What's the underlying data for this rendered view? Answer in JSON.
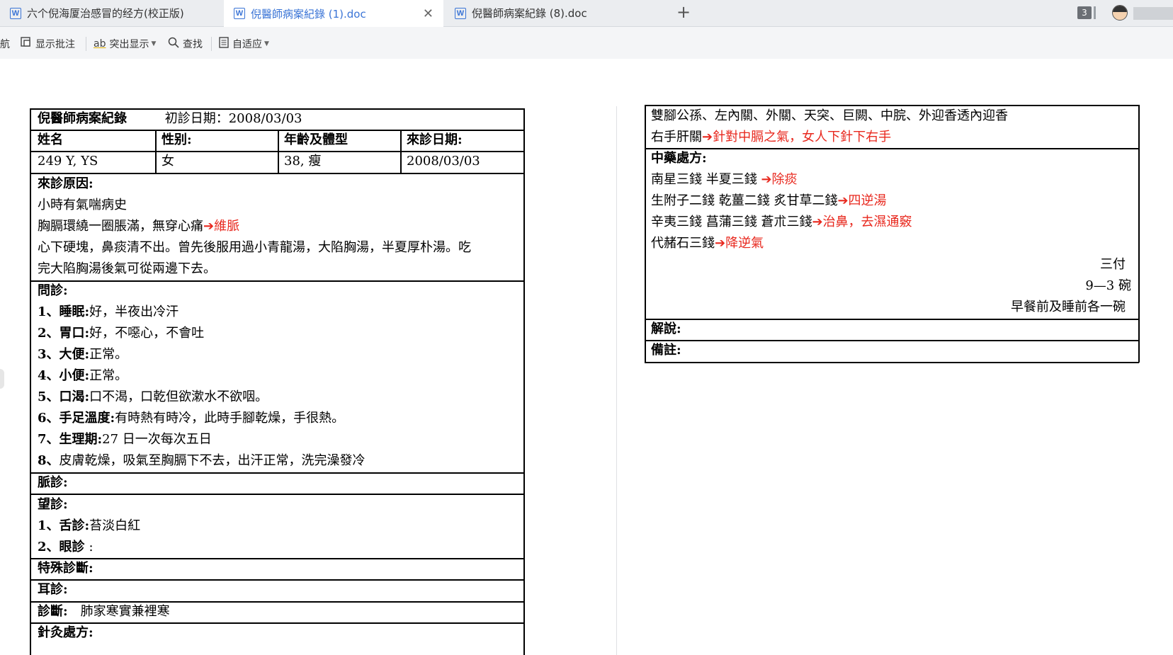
{
  "tabs": [
    {
      "label": "六个倪海厦治感冒的经方(校正版)",
      "active": false
    },
    {
      "label": "倪醫師病案紀錄 (1).doc",
      "active": true
    },
    {
      "label": "倪醫師病案紀錄 (8).doc",
      "active": false
    }
  ],
  "tab_badge_count": "3",
  "toolbar": {
    "nav_label": "導航",
    "show_comments": "显示批注",
    "highlight": "突出显示",
    "find": "查找",
    "fit": "自适应"
  },
  "record": {
    "title": "倪醫師病案紀錄",
    "first_visit_label": "初診日期：2008/03/03",
    "headers": [
      "姓名",
      "性别:",
      "年齡及體型",
      "來診日期:"
    ],
    "values": [
      "249 Y, YS",
      "女",
      "38, 瘦",
      "2008/03/03"
    ],
    "reason_label": "來診原因:",
    "reason_lines": [
      {
        "text": "小時有氣喘病史"
      },
      {
        "text": "胸膈環繞一圈脹滿，無穿心痛",
        "note": "➔維脈"
      },
      {
        "text": "心下硬塊，鼻痰清不出。曾先後服用過小青龍湯，大陷胸湯，半夏厚朴湯。吃"
      },
      {
        "text": "完大陷胸湯後氣可從兩邊下去。"
      }
    ],
    "inquiry_label": "問診:",
    "inquiry": [
      {
        "key": "1、睡眠:",
        "val": "好，半夜出冷汗"
      },
      {
        "key": "2、胃口:",
        "val": "好，不噁心，不會吐"
      },
      {
        "key": "3、大便:",
        "val": "正常。"
      },
      {
        "key": "4、小便:",
        "val": "正常。"
      },
      {
        "key": "5、口渴:",
        "val": "口不渴，口乾但欲漱水不欲咽。"
      },
      {
        "key": "6、手足溫度:",
        "val": "有時熱有時冷，此時手腳乾燥，手很熱。"
      },
      {
        "key": "7、生理期:",
        "val": "27 日一次每次五日"
      },
      {
        "key": "8、",
        "val": "皮膚乾燥，吸氣至胸膈下不去，出汗正常，洗完澡發冷"
      }
    ],
    "pulse_label": "脈診:",
    "look_label": "望診:",
    "look": [
      {
        "key": "1、舌診:",
        "val": "苔淡白紅"
      },
      {
        "key": "2、眼診",
        "val": ":"
      }
    ],
    "special_label": "特殊診斷:",
    "ear_label": "耳診:",
    "diagnosis_label": "診斷:",
    "diagnosis_value": "肺家寒實兼裡寒",
    "acupuncture_label": "針灸處方:"
  },
  "right": {
    "acu_line1": "雙腳公孫、左內關、外關、天突、巨闕、中脘、外迎香透內迎香",
    "acu_line2_text": "右手肝關",
    "acu_line2_note": "➔針對中膈之氣，女人下針下右手",
    "herb_label": "中藥處方:",
    "herbs": [
      {
        "text": "南星三錢 半夏三錢 ",
        "note": "➔除痰"
      },
      {
        "text": "生附子二錢 乾薑二錢 炙甘草二錢",
        "note": "➔四逆湯"
      },
      {
        "text": "辛夷三錢 菖蒲三錢 蒼朮三錢",
        "note": "➔治鼻，去濕通竅"
      },
      {
        "text": "代赭石三錢",
        "note": "➔降逆氣"
      }
    ],
    "dose1": "三付",
    "dose2": "9—3 碗",
    "dose3": "早餐前及睡前各一碗",
    "explain_label": "解說:",
    "remark_label": "備註:"
  },
  "colors": {
    "accent_tab": "#3a74d6",
    "note_red": "#e8281e"
  }
}
